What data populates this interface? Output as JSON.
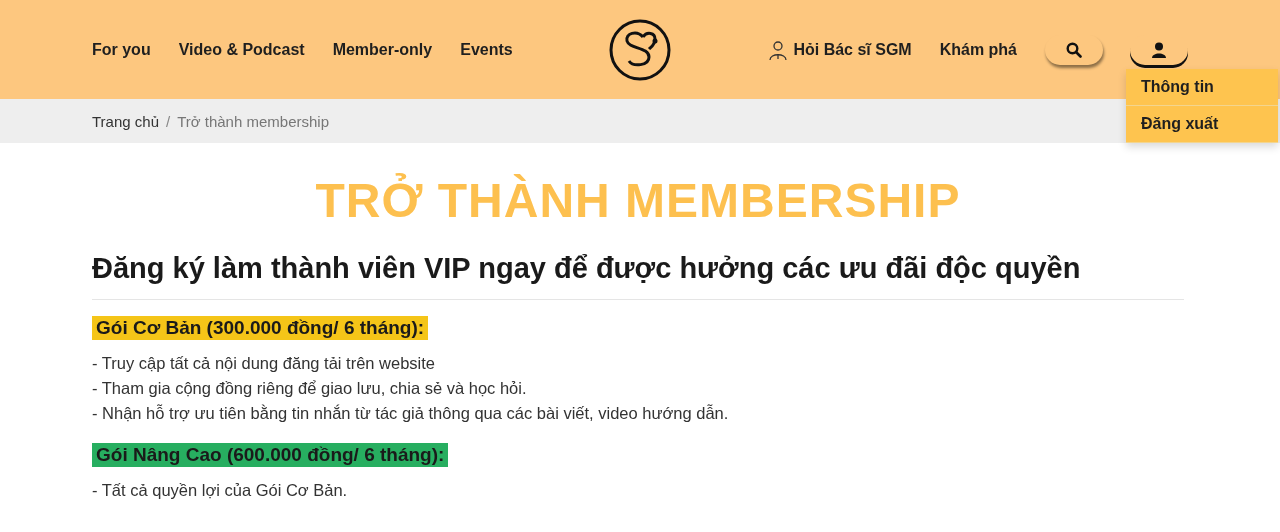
{
  "nav_left": [
    {
      "label": "For you"
    },
    {
      "label": "Video & Podcast"
    },
    {
      "label": "Member-only"
    },
    {
      "label": "Events"
    }
  ],
  "nav_right": [
    {
      "label": "Hỏi Bác sĩ SGM",
      "kind": "doctor"
    },
    {
      "label": "Khám phá",
      "kind": "plain"
    }
  ],
  "user_menu": {
    "expanded": true,
    "items": [
      {
        "label": "Thông tin"
      },
      {
        "label": "Đăng xuất"
      }
    ]
  },
  "breadcrumb": [
    {
      "label": "Trang chủ"
    },
    {
      "label": "Trở thành membership"
    }
  ],
  "breadcrumb_separator": "/",
  "title": "TRỞ THÀNH MEMBERSHIP",
  "subtitle": "Đăng ký làm thành viên VIP ngay để được hưởng các ưu đãi độc quyền",
  "plans": [
    {
      "name": "Gói Cơ Bản (300.000 đồng/ 6 tháng):",
      "color": "#f5c518",
      "benefits": [
        "- Truy cập tất cả nội dung đăng tải trên website",
        "- Tham gia cộng đồng riêng để giao lưu, chia sẻ và học hỏi.",
        "- Nhận hỗ trợ ưu tiên bằng tin nhắn từ tác giả thông qua các bài viết, video hướng dẫn."
      ]
    },
    {
      "name": "Gói Nâng Cao (600.000 đồng/ 6 tháng):",
      "color": "#27ae60",
      "benefits": [
        "- Tất cả quyền lợi của Gói Cơ Bản."
      ]
    }
  ]
}
